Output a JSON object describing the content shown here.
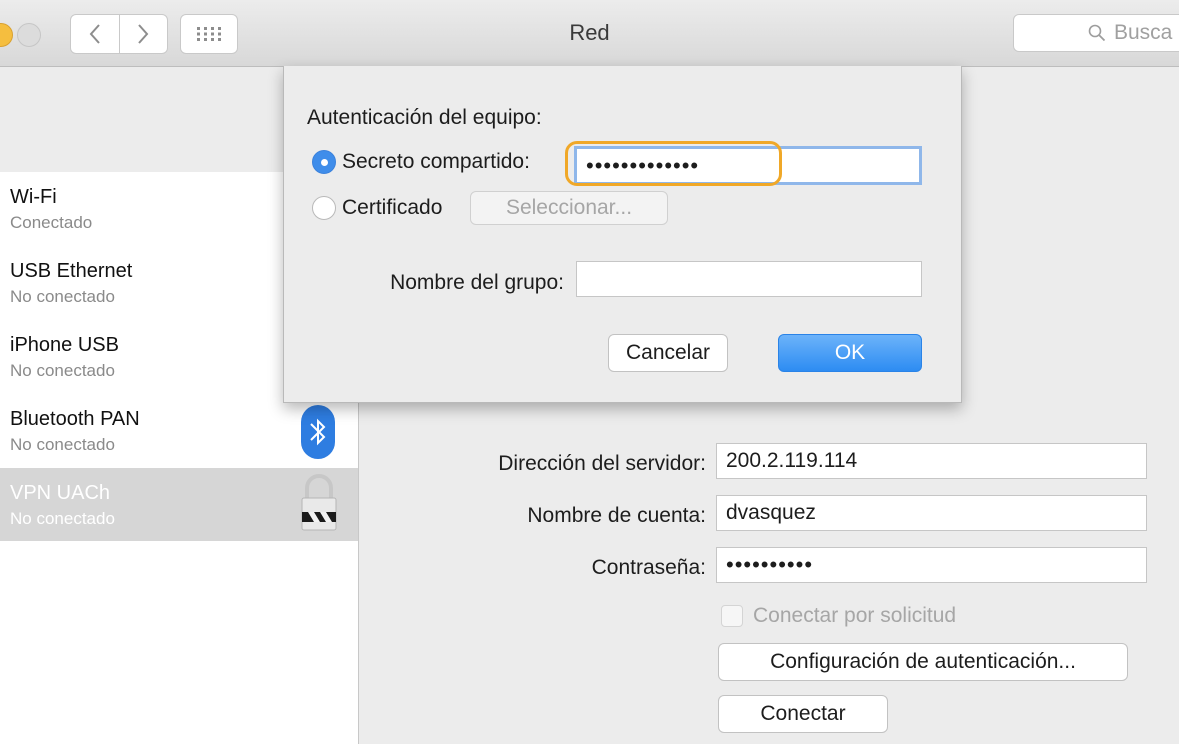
{
  "window": {
    "title": "Red"
  },
  "search": {
    "placeholder": "Busca"
  },
  "sidebar": {
    "items": [
      {
        "name": "Wi-Fi",
        "status": "Conectado"
      },
      {
        "name": "USB Ethernet",
        "status": "No conectado"
      },
      {
        "name": "iPhone USB",
        "status": "No conectado"
      },
      {
        "name": "Bluetooth PAN",
        "status": "No conectado",
        "icon": "bluetooth-icon"
      },
      {
        "name": "VPN UACh",
        "status": "No conectado",
        "icon": "vpn-lock-icon",
        "selected": true
      }
    ]
  },
  "detail": {
    "server_label": "Dirección del servidor:",
    "server_value": "200.2.119.114",
    "account_label": "Nombre de cuenta:",
    "account_value": "dvasquez",
    "password_label": "Contraseña:",
    "password_value": "••••••••••",
    "on_demand_label": "Conectar por solicitud",
    "auth_settings_button": "Configuración de autenticación...",
    "connect_button": "Conectar"
  },
  "sheet": {
    "title": "Autenticación del equipo:",
    "shared_secret_label": "Secreto compartido:",
    "shared_secret_value": "•••••••••••••",
    "certificate_label": "Certificado",
    "select_button": "Seleccionar...",
    "group_label": "Nombre del grupo:",
    "group_value": "",
    "cancel_button": "Cancelar",
    "ok_button": "OK"
  },
  "colors": {
    "accent": "#3f8dea",
    "highlight_ring": "#f0a828",
    "bluetooth": "#2e7de1"
  }
}
